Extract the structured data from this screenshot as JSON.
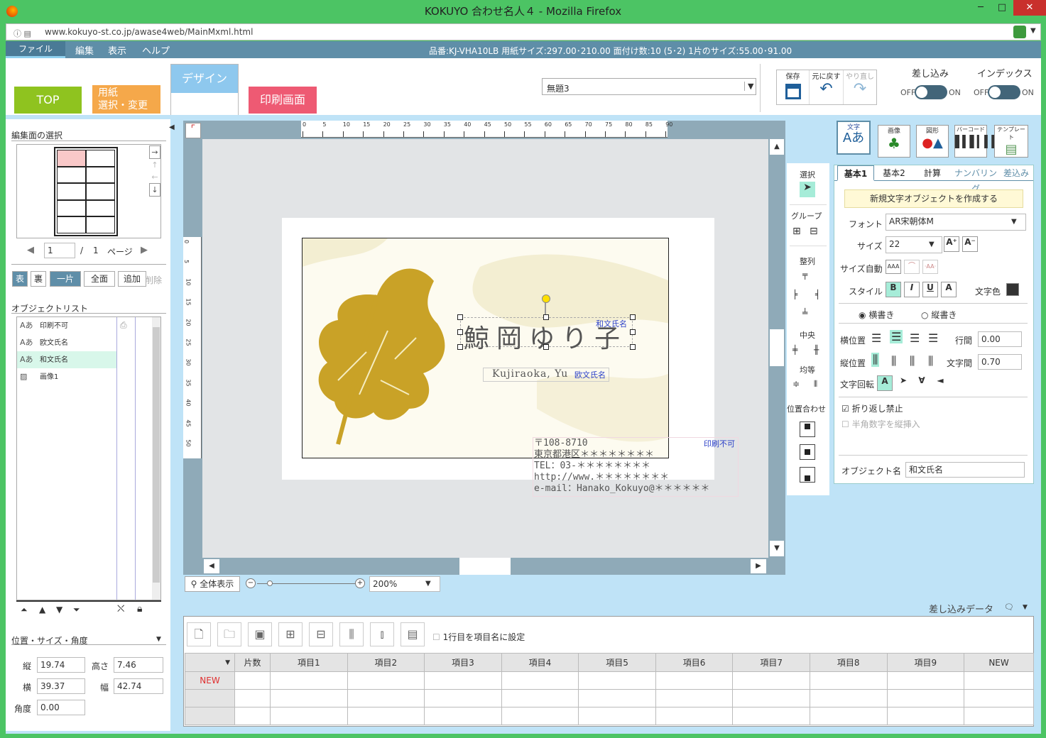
{
  "window": {
    "title": "KOKUYO 合わせ名人４ - Mozilla Firefox",
    "url": "www.kokuyo-st.co.jp/awase4web/MainMxml.html"
  },
  "menu": {
    "items": [
      "ファイル",
      "編集",
      "表示",
      "ヘルプ"
    ],
    "info": "品番:KJ-VHA10LB  用紙サイズ:297.00･210.00  面付け数:10 (5･2)  1片のサイズ:55.00･91.00"
  },
  "tabs": {
    "top": "TOP",
    "paper": "用紙\n選択・変更",
    "design": "デザイン",
    "print": "印刷画面"
  },
  "docselect": {
    "value": "無題3"
  },
  "actions": {
    "save": "保存",
    "undo": "元に戻す",
    "redo": "やり直し"
  },
  "merge": {
    "label": "差し込み",
    "off": "OFF",
    "on": "ON"
  },
  "index": {
    "label": "インデックス",
    "off": "OFF",
    "on": "ON"
  },
  "left": {
    "edit_select_label": "編集面の選択",
    "page": "1",
    "page_total": "1",
    "page_word": "ページ",
    "slash": "/",
    "face_front": "表",
    "face_back": "裏",
    "one_piece": "一片",
    "all": "全面",
    "add": "追加",
    "delete": "削除",
    "objlist_label": "オブジェクトリスト",
    "objects": [
      {
        "icon": "Aあ",
        "name": "印刷不可"
      },
      {
        "icon": "Aあ",
        "name": "欧文氏名"
      },
      {
        "icon": "Aあ",
        "name": "和文氏名"
      },
      {
        "icon": "▨",
        "name": "画像1"
      }
    ],
    "pos_label": "位置・サイズ・角度",
    "tate_label": "縦",
    "tate": "19.74",
    "takasa_label": "高さ",
    "takasa": "7.46",
    "yoko_label": "横",
    "yoko": "39.37",
    "haba_label": "幅",
    "haba": "42.74",
    "kakudo_label": "角度",
    "kakudo": "0.00"
  },
  "canvas": {
    "ruler_top": [
      "0",
      "5",
      "10",
      "15",
      "20",
      "25",
      "30",
      "35",
      "40",
      "45",
      "50",
      "55",
      "60",
      "65",
      "70",
      "75",
      "80",
      "85",
      "90"
    ],
    "ruler_left": [
      "0",
      "5",
      "10",
      "15",
      "20",
      "25",
      "30",
      "35",
      "40",
      "45",
      "50"
    ],
    "name_jp": "鯨岡ゆり子",
    "name_jp_tag": "和文氏名",
    "name_en": "Kujiraoka, Yu",
    "name_en_tag": "欧文氏名",
    "address_tag": "印刷不可",
    "address": [
      "〒108-8710",
      "東京都港区＊＊＊＊＊＊＊＊",
      "TEL：03-＊＊＊＊＊＊＊＊",
      "http://www.＊＊＊＊＊＊＊＊",
      "e-mail：Hanako_Kokuyo@＊＊＊＊＊＊"
    ],
    "fit_label": "全体表示",
    "zoom": "200%"
  },
  "tools": {
    "select": "選択",
    "group": "グループ",
    "align": "整列",
    "center": "中央",
    "even": "均等",
    "position": "位置合わせ"
  },
  "right": {
    "cats": [
      "文字",
      "画像",
      "図形",
      "バーコード",
      "テンプレート"
    ],
    "tabs": [
      "基本1",
      "基本2",
      "計算",
      "ナンバリング",
      "差込み"
    ],
    "create_btn": "新規文字オブジェクトを作成する",
    "font_label": "フォント",
    "font": "AR宋朝体M",
    "size_label": "サイズ",
    "size": "22",
    "autosize_label": "サイズ自動",
    "style_label": "スタイル",
    "color_label": "文字色",
    "horizontal": "横書き",
    "vertical": "縦書き",
    "hpos_label": "横位置",
    "vpos_label": "縦位置",
    "linesp_label": "行間",
    "linesp": "0.00",
    "charsp_label": "文字間",
    "charsp": "0.70",
    "rotate_label": "文字回転",
    "nowrap": "折り返し禁止",
    "halfwidth": "半角数字を縦挿入",
    "objname_label": "オブジェクト名",
    "objname": "和文氏名"
  },
  "merge_data": {
    "label": "差し込みデータ",
    "first_row": "1行目を項目名に設定",
    "headers": [
      "",
      "片数",
      "項目1",
      "項目2",
      "項目3",
      "項目4",
      "項目5",
      "項目6",
      "項目7",
      "項目8",
      "項目9",
      "NEW"
    ],
    "new_row": "NEW"
  },
  "colors": {
    "top_tab": "#8fc31f",
    "paper_tab": "#f5a84a",
    "design_tab": "#8ec8ee",
    "print_tab": "#ee5a73",
    "leaf": "#c9a227",
    "menu": "#5f8ea8"
  }
}
